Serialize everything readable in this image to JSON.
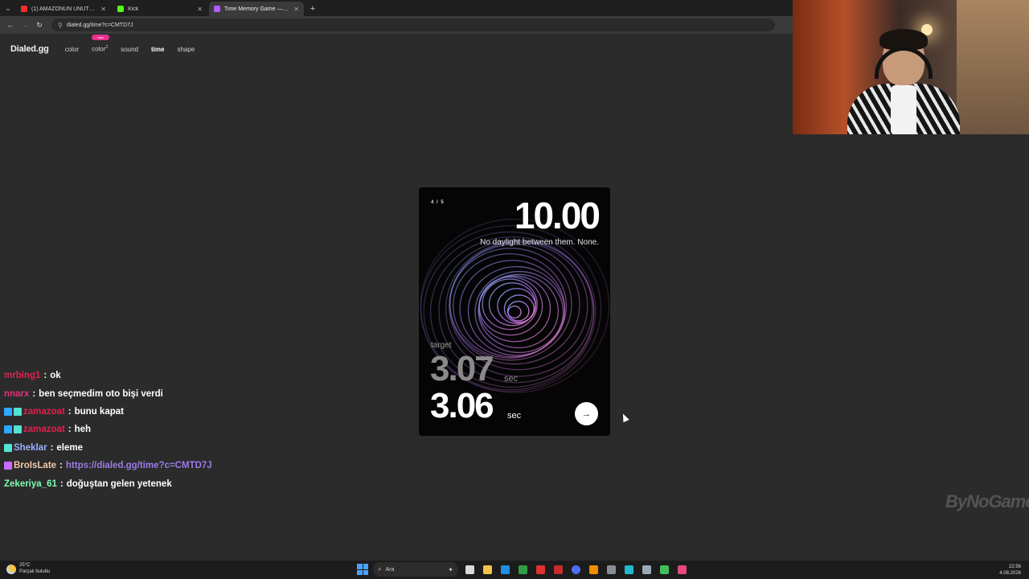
{
  "browser": {
    "tabs": [
      {
        "title": "(1) AMAZONUN UNUTULAN K",
        "fav_color": "#ff2b2b",
        "active": false
      },
      {
        "title": "Kick",
        "fav_color": "#53fc18",
        "active": false
      },
      {
        "title": "Time Memory Game — Ho",
        "fav_color": "#b05cff",
        "active": true
      }
    ],
    "new_tab": "+",
    "address": "dialed.gg/time?c=CMTD7J"
  },
  "site": {
    "logo": "Dialed.gg",
    "nav": [
      {
        "label": "color",
        "active": false
      },
      {
        "label": "color",
        "sup": "2",
        "badge": "new",
        "active": false
      },
      {
        "label": "sound",
        "active": false
      },
      {
        "label": "time",
        "active": true
      },
      {
        "label": "shape",
        "active": false
      }
    ]
  },
  "game": {
    "round": "4 / 5",
    "goal": "10.00",
    "quip": "No daylight between them. None.",
    "target_label": "target",
    "target_value": "3.07",
    "target_unit": "sec",
    "your_value": "3.06",
    "your_unit": "sec",
    "next_icon": "arrow-right-icon"
  },
  "chat": [
    {
      "user": "mrbing1",
      "color": "#e0224f",
      "badges": [],
      "text": "ok"
    },
    {
      "user": "nnarx",
      "color": "#e8307a",
      "badges": [],
      "text": "ben seçmedim oto bişi verdi"
    },
    {
      "user": "zamazoat",
      "color": "#e0224f",
      "badges": [
        "#2fa8ff",
        "#52e3d2"
      ],
      "text": "bunu kapat"
    },
    {
      "user": "zamazoat",
      "color": "#e0224f",
      "badges": [
        "#2fa8ff",
        "#52e3d2"
      ],
      "text": "heh"
    },
    {
      "user": "Sheklar",
      "color": "#9bb0ff",
      "badges": [
        "#52e3d2"
      ],
      "text": "eleme"
    },
    {
      "user": "BroIsLate",
      "color": "#f3c9a8",
      "badges": [
        "#c86bff"
      ],
      "text": "",
      "link": "https://dialed.gg/time?c=CMTD7J"
    },
    {
      "user": "Zekeriya_61",
      "color": "#7dffb0",
      "badges": [],
      "text": "doğuştan gelen yetenek"
    }
  ],
  "chat_separator": ":",
  "watermark": "ByNoGame",
  "taskbar": {
    "temp": "25°C",
    "weather": "Parçalı bulutlu",
    "search_placeholder": "Ara",
    "time": "22:56",
    "date": "4.08.2026",
    "apps": [
      "#d9d9d9",
      "#f2c14e",
      "#1e8fe1",
      "#2f9e44",
      "#e03131",
      "#c92a2a",
      "#4c6ef5",
      "#f08c00",
      "#868e96",
      "#22b8cf",
      "#9aa9b8",
      "#40c057",
      "#e64980"
    ]
  }
}
